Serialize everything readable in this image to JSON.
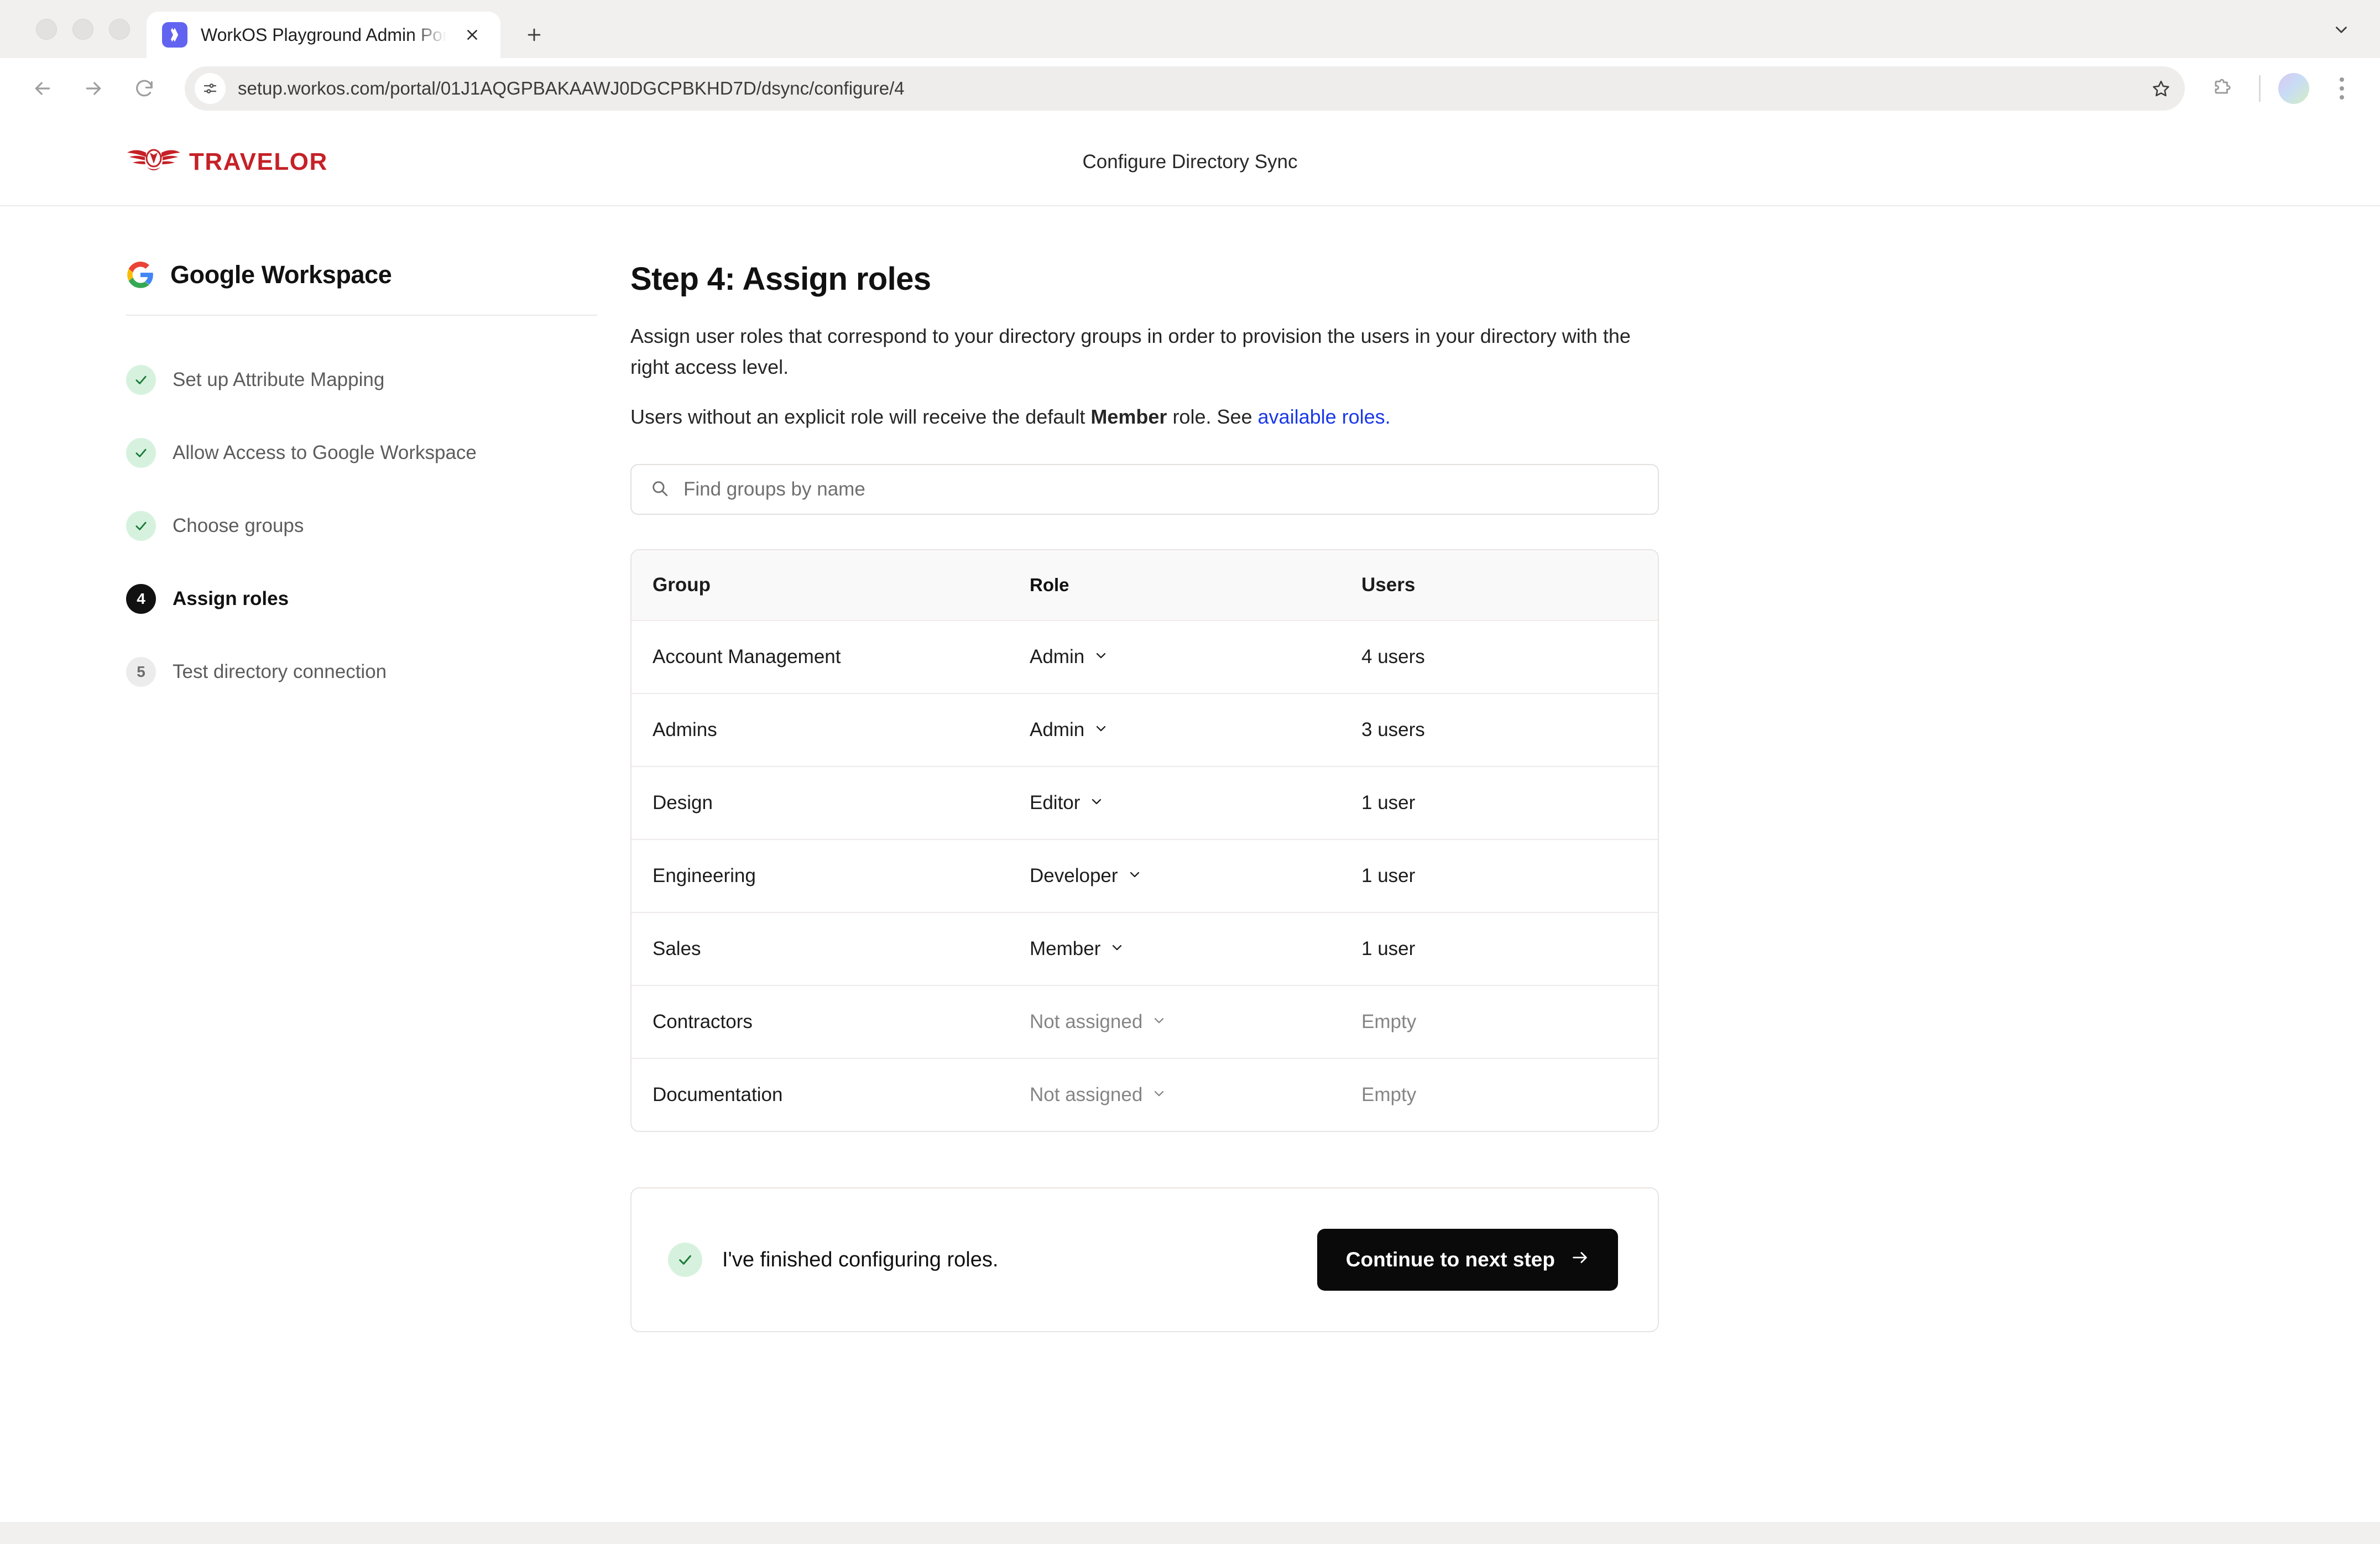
{
  "browser": {
    "tab": {
      "title": "WorkOS Playground Admin Portal",
      "favicon_icon": "workos-logo-icon",
      "close_icon": "close-icon"
    },
    "new_tab_icon": "plus-icon",
    "tab_list_icon": "chevron-down-icon",
    "back_icon": "arrow-left-icon",
    "forward_icon": "arrow-right-icon",
    "reload_icon": "reload-icon",
    "site_info_icon": "site-settings-icon",
    "url": "setup.workos.com/portal/01J1AQGPBAKAAWJ0DGCPBKHD7D/dsync/configure/4",
    "bookmark_icon": "star-icon",
    "extensions_icon": "puzzle-piece-icon",
    "profile_icon": "avatar",
    "menu_icon": "three-dot-menu-icon"
  },
  "page": {
    "brand": {
      "name": "TRAVELOR",
      "color": "#c52127",
      "mark_icon": "winged-emblem-icon"
    },
    "header_title": "Configure Directory Sync"
  },
  "sidebar": {
    "directory": {
      "name": "Google Workspace",
      "icon": "google-logo-icon"
    },
    "steps": [
      {
        "label": "Set up Attribute Mapping",
        "badge": "✓",
        "state": "done"
      },
      {
        "label": "Allow Access to Google Workspace",
        "badge": "✓",
        "state": "done"
      },
      {
        "label": "Choose groups",
        "badge": "✓",
        "state": "done"
      },
      {
        "label": "Assign roles",
        "badge": "4",
        "state": "current"
      },
      {
        "label": "Test directory connection",
        "badge": "5",
        "state": "pending"
      }
    ]
  },
  "main": {
    "title": "Step 4: Assign roles",
    "description": "Assign user roles that correspond to your directory groups in order to provision the users in your directory with the right access level.",
    "default_role_text_before": "Users without an explicit role will receive the default ",
    "default_role_bold": "Member",
    "default_role_text_after": " role. See ",
    "available_roles_link": "available roles.",
    "link_color": "#1a38e8",
    "search": {
      "placeholder": "Find groups by name",
      "value": "",
      "icon": "search-icon"
    },
    "table": {
      "columns": [
        "Group",
        "Role",
        "Users"
      ],
      "rows": [
        {
          "group": "Account Management",
          "role": "Admin",
          "role_assigned": true,
          "users": "4 users",
          "users_empty": false
        },
        {
          "group": "Admins",
          "role": "Admin",
          "role_assigned": true,
          "users": "3 users",
          "users_empty": false
        },
        {
          "group": "Design",
          "role": "Editor",
          "role_assigned": true,
          "users": "1 user",
          "users_empty": false
        },
        {
          "group": "Engineering",
          "role": "Developer",
          "role_assigned": true,
          "users": "1 user",
          "users_empty": false
        },
        {
          "group": "Sales",
          "role": "Member",
          "role_assigned": true,
          "users": "1 user",
          "users_empty": false
        },
        {
          "group": "Contractors",
          "role": "Not assigned",
          "role_assigned": false,
          "users": "Empty",
          "users_empty": true
        },
        {
          "group": "Documentation",
          "role": "Not assigned",
          "role_assigned": false,
          "users": "Empty",
          "users_empty": true
        }
      ]
    },
    "finish": {
      "text": "I've finished configuring roles.",
      "check_icon": "check-icon",
      "button_label": "Continue to next step",
      "button_icon": "arrow-right-icon"
    }
  }
}
